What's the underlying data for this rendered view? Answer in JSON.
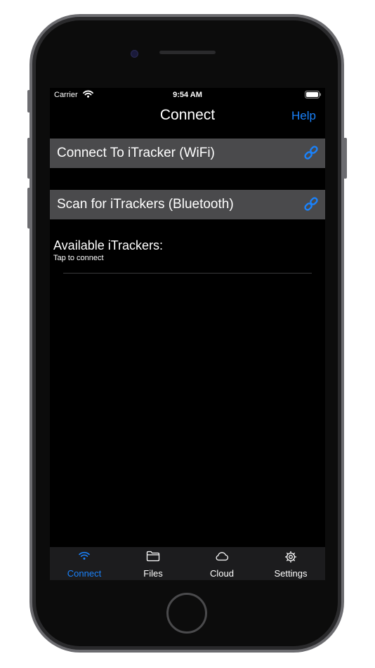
{
  "status_bar": {
    "carrier": "Carrier",
    "time": "9:54 AM"
  },
  "nav": {
    "title": "Connect",
    "help_label": "Help"
  },
  "actions": [
    {
      "label": "Connect To iTracker (WiFi)",
      "icon": "link-icon"
    },
    {
      "label": "Scan for iTrackers (Bluetooth)",
      "icon": "link-icon"
    }
  ],
  "available": {
    "title": "Available iTrackers:",
    "subtitle": "Tap to connect"
  },
  "tabs": [
    {
      "label": "Connect",
      "icon": "wifi-icon",
      "selected": true
    },
    {
      "label": "Files",
      "icon": "folder-icon",
      "selected": false
    },
    {
      "label": "Cloud",
      "icon": "cloud-icon",
      "selected": false
    },
    {
      "label": "Settings",
      "icon": "gear-icon",
      "selected": false
    }
  ],
  "colors": {
    "accent": "#1a82fb",
    "background": "#000000",
    "row_background": "#4a4a4c",
    "tab_bar_background": "#1c1c1e"
  }
}
